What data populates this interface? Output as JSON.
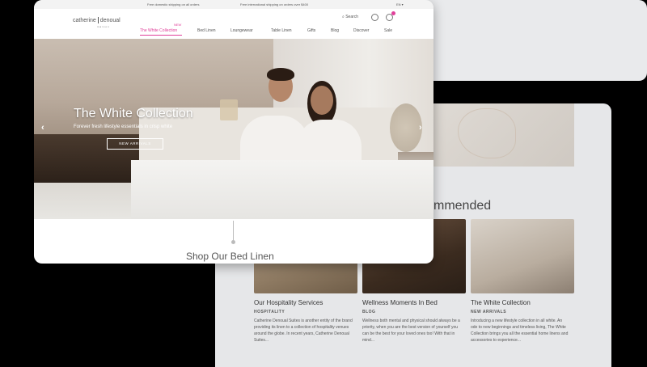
{
  "promo_bar": {
    "item1": "Free domestic shipping on all orders",
    "item2": "Free international shipping on orders over $400",
    "language": "EN"
  },
  "header": {
    "logo_left": "catherine",
    "logo_right": "denoual",
    "logo_sub": "maison",
    "nav": {
      "new_badge": "NEW",
      "items": [
        "The White Collection",
        "Bed Linen",
        "Loungewear",
        "Table Linen",
        "Gifts",
        "Blog",
        "Discover",
        "Sale"
      ]
    },
    "search_label": "Search"
  },
  "hero": {
    "title": "The White Collection",
    "subtitle": "Forever fresh lifestyle essentials in crisp white",
    "cta": "NEW ARRIVALS"
  },
  "section": {
    "shop_title": "Shop Our Bed Linen",
    "recommended_partial": "mmended"
  },
  "recommended": [
    {
      "title": "Our Hospitality Services",
      "category": "HOSPITALITY",
      "desc": "Catherine Denoual Suites is another entity of the brand providing its linen to a collection of hospitality venues around the globe. In recent years, Catherine Denoual Suites..."
    },
    {
      "title": "Wellness Moments In Bed",
      "category": "BLOG",
      "desc": "Wellness both mental and physical should always be a priority, when you are the best version of yourself you can be the best for your loved ones too! With that in mind..."
    },
    {
      "title": "The White Collection",
      "category": "NEW ARRIVALS",
      "desc": "Introducing a new lifestyle collection in all white. An ode to new beginnings and timeless living, The White Collection brings you all the essential home linens and accessories to experience..."
    }
  ],
  "colors": {
    "accent": "#e0409a",
    "background": "#000000"
  }
}
